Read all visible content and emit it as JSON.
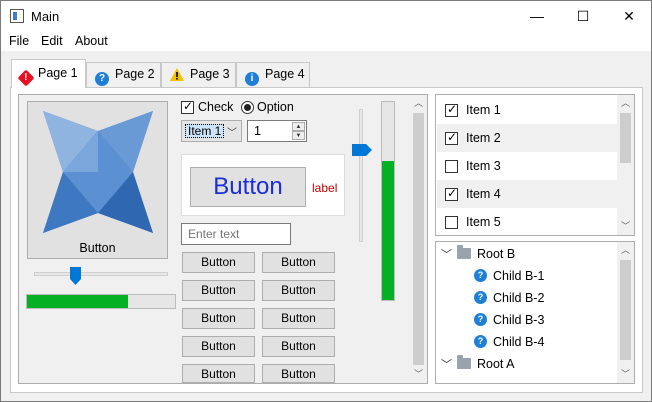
{
  "window": {
    "title": "Main",
    "minimize_glyph": "—",
    "maximize_glyph": "☐",
    "close_glyph": "✕"
  },
  "menu": {
    "file": "File",
    "edit": "Edit",
    "about": "About"
  },
  "tabs": [
    {
      "label": "Page 1",
      "icon": "error-icon",
      "icon_color": "#e81123"
    },
    {
      "label": "Page 2",
      "icon": "question-icon",
      "icon_color": "#1e7fd8"
    },
    {
      "label": "Page 3",
      "icon": "warning-icon",
      "icon_color": "#f2c200"
    },
    {
      "label": "Page 4",
      "icon": "info-icon",
      "icon_color": "#1e7fd8"
    }
  ],
  "page1": {
    "image_button_label": "Button",
    "slider_value": 0.3,
    "progress_value": 0.68,
    "check_label": "Check",
    "check_checked": true,
    "option_label": "Option",
    "option_selected": true,
    "combo_value": "Item 1",
    "spin_value": "1",
    "big_button_label": "Button",
    "red_label": "label",
    "text_placeholder": "Enter text",
    "grid_buttons": [
      "Button",
      "Button",
      "Button",
      "Button",
      "Button",
      "Button",
      "Button",
      "Button",
      "Button",
      "Button"
    ],
    "vslider_value": 0.7,
    "vprogress_value": 0.7
  },
  "list": {
    "items": [
      {
        "label": "Item 1",
        "checked": true
      },
      {
        "label": "Item 2",
        "checked": true
      },
      {
        "label": "Item 3",
        "checked": false
      },
      {
        "label": "Item 4",
        "checked": true
      },
      {
        "label": "Item 5",
        "checked": false
      }
    ]
  },
  "tree": {
    "rows": [
      {
        "label": "Root B",
        "type": "folder",
        "expanded": true
      },
      {
        "label": "Child B-1",
        "type": "child"
      },
      {
        "label": "Child B-2",
        "type": "child"
      },
      {
        "label": "Child B-3",
        "type": "child"
      },
      {
        "label": "Child B-4",
        "type": "child"
      },
      {
        "label": "Root A",
        "type": "folder",
        "expanded": true
      }
    ]
  },
  "colors": {
    "accent": "#0078d7",
    "progress": "#06b025",
    "label_red": "#c00000",
    "button_text_blue": "#1a2ed6"
  }
}
